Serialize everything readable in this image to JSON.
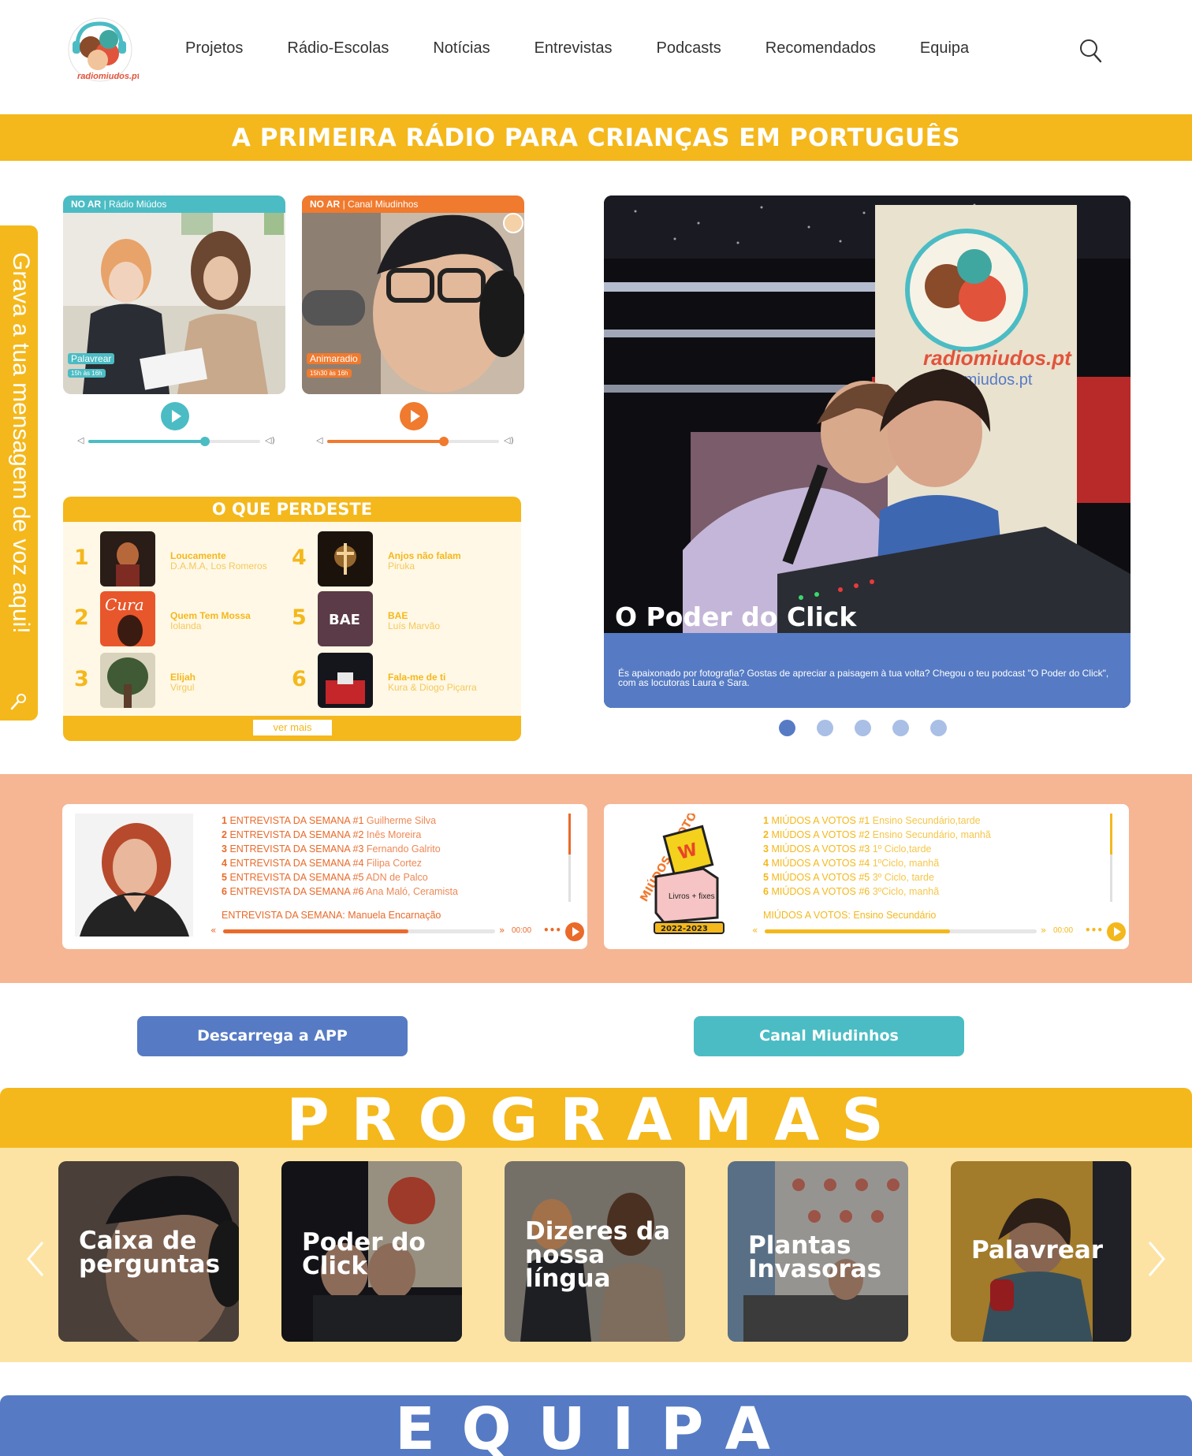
{
  "header": {
    "logo_text": "radiomiudos.pt",
    "nav": [
      "Projetos",
      "Rádio-Escolas",
      "Notícias",
      "Entrevistas",
      "Podcasts",
      "Recomendados",
      "Equipa"
    ]
  },
  "banner": {
    "text": "A PRIMEIRA RÁDIO PARA CRIANÇAS EM PORTUGUÊS"
  },
  "side_tab": {
    "text": "Grava a tua mensagem de voz aqui!",
    "icon": "microphone-icon"
  },
  "players": [
    {
      "on_air": "NO AR",
      "channel": "Rádio Miúdos",
      "program": "Palavrear",
      "time": "15h às 16h",
      "color": "#4bbcc4",
      "volume": 0.68
    },
    {
      "on_air": "NO AR",
      "channel": "Canal Miudinhos",
      "program": "Animaradio",
      "time": "15h30 às 16h",
      "color": "#f07a2e",
      "volume": 0.68
    }
  ],
  "perdeste": {
    "title": "O QUE PERDESTE",
    "more": "ver mais",
    "items": [
      {
        "num": "1",
        "title": "Loucamente",
        "artist": "D.A.M.A, Los Romeros"
      },
      {
        "num": "2",
        "title": "Quem Tem Mossa",
        "artist": "Iolanda"
      },
      {
        "num": "3",
        "title": "Elijah",
        "artist": "Virgul"
      },
      {
        "num": "4",
        "title": "Anjos não falam",
        "artist": "Piruka"
      },
      {
        "num": "5",
        "title": "BAE",
        "artist": "Luís Marvão"
      },
      {
        "num": "6",
        "title": "Fala-me de ti",
        "artist": "Kura & Diogo Piçarra"
      }
    ]
  },
  "hero": {
    "title": "O Poder do Click",
    "description": "És apaixonado por fotografia? Gostas de apreciar a paisagem à tua volta? Chegou o teu podcast \"O Poder do Click\", com as locutoras Laura e Sara.",
    "slides": 5,
    "active": 0
  },
  "interviews": {
    "items": [
      {
        "n": "1",
        "label": "ENTREVISTA DA SEMANA #1",
        "who": "Guilherme Silva"
      },
      {
        "n": "2",
        "label": "ENTREVISTA DA SEMANA #2",
        "who": "Inês Moreira"
      },
      {
        "n": "3",
        "label": "ENTREVISTA DA SEMANA #3",
        "who": "Fernando Galrito"
      },
      {
        "n": "4",
        "label": "ENTREVISTA DA SEMANA #4",
        "who": "Filipa Cortez"
      },
      {
        "n": "5",
        "label": "ENTREVISTA DA SEMANA #5",
        "who": "ADN de Palco"
      },
      {
        "n": "6",
        "label": "ENTREVISTA DA SEMANA #6",
        "who": "Ana Maló, Ceramista"
      }
    ],
    "now_label": "ENTREVISTA DA SEMANA:",
    "now_value": "Manuela Encarnação",
    "time": "00:00",
    "progress": 0.68,
    "color": "#ea6a2a"
  },
  "votes": {
    "badge_year": "2022-2023",
    "badge_title": "MIÚDOS A VOTOS!",
    "badge_box": "Livros + fixes",
    "items": [
      {
        "n": "1",
        "label": "MIÚDOS A VOTOS #1",
        "who": "Ensino Secundário,tarde"
      },
      {
        "n": "2",
        "label": "MIÚDOS A VOTOS #2",
        "who": "Ensino Secundário, manhã"
      },
      {
        "n": "3",
        "label": "MIÚDOS A VOTOS #3",
        "who": "1º Ciclo,tarde"
      },
      {
        "n": "4",
        "label": "MIÚDOS A VOTOS  #4",
        "who": "1ºCiclo, manhã"
      },
      {
        "n": "5",
        "label": "MIÚDOS A VOTOS #5",
        "who": "3º Ciclo, tarde"
      },
      {
        "n": "6",
        "label": "MIÚDOS A VOTOS #6",
        "who": "3ºCiclo, manhã"
      }
    ],
    "now_label": "MIÚDOS A VOTOS:",
    "now_value": "Ensino Secundário",
    "time": "00:00",
    "progress": 0.68,
    "color": "#f4b81c"
  },
  "buttons": {
    "app": "Descarrega a APP",
    "channel": "Canal Miudinhos"
  },
  "programas": {
    "title": "PROGRAMAS",
    "cards": [
      "Caixa de perguntas",
      "Poder do Click",
      "Dizeres da nossa língua",
      "Plantas Invasoras",
      "Palavrear"
    ]
  },
  "equipa": {
    "title": "EQUIPA"
  },
  "colors": {
    "yellow": "#f4b81c",
    "teal": "#4bbcc4",
    "orange": "#f07a2e",
    "blue": "#567bc4",
    "salmon": "#f6b593"
  }
}
